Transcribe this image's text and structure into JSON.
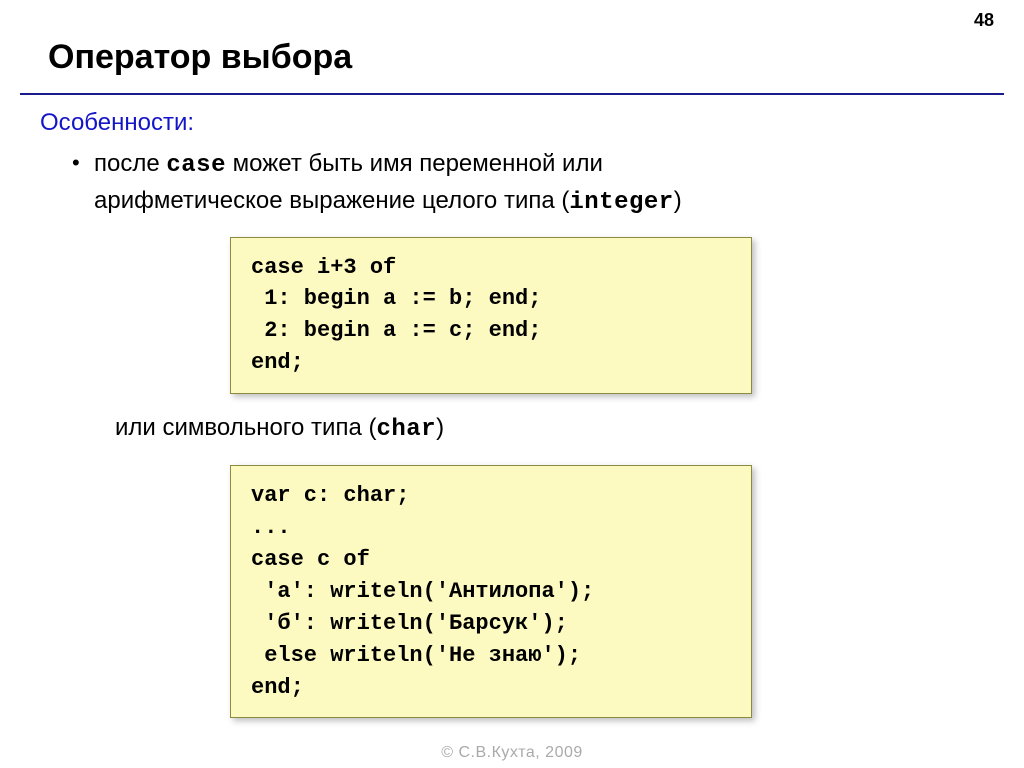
{
  "page_number": "48",
  "title": "Оператор выбора",
  "section_label": "Особенности:",
  "bullet": {
    "pre": "после ",
    "kw": "case",
    "mid": " может быть имя переменной или",
    "line2_a": "арифметическое выражение целого типа (",
    "line2_kw": "integer",
    "line2_b": ")"
  },
  "code1": "case i+3 of\n 1: begin a := b; end;\n 2: begin a := c; end;\nend;",
  "between": {
    "a": "или символьного типа (",
    "kw": "char",
    "b": ")"
  },
  "code2": "var c: char;\n...\ncase c of\n 'а': writeln('Антилопа');\n 'б': writeln('Барсук');\n else writeln('Не знаю');\nend;",
  "footer": "© С.В.Кухта, 2009"
}
